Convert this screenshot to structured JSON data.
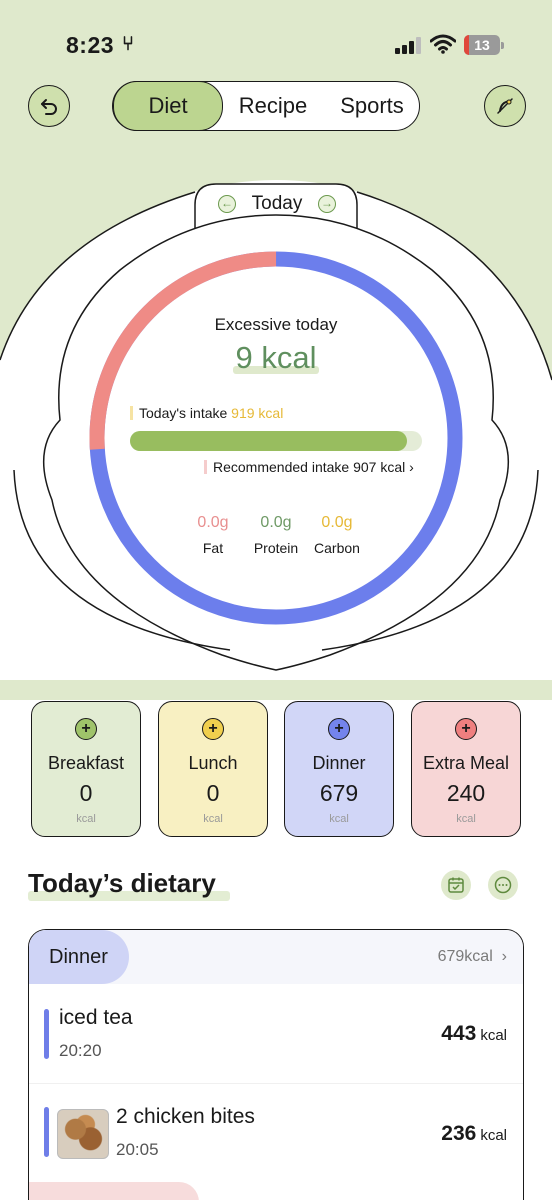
{
  "status_bar": {
    "time": "8:23",
    "battery": "13"
  },
  "tabs": [
    {
      "label": "Diet",
      "active": true
    },
    {
      "label": "Recipe",
      "active": false
    },
    {
      "label": "Sports",
      "active": false
    }
  ],
  "summary": {
    "day_label": "Today",
    "status_label": "Excessive today",
    "excess_value": "9 kcal",
    "intake_label": "Today's intake",
    "intake_value": "919 kcal",
    "recommended_text": "Recommended intake 907 kcal",
    "intake_ratio": 0.95,
    "macros": [
      {
        "value": "0.0g",
        "label": "Fat",
        "color": "#e88f8f"
      },
      {
        "value": "0.0g",
        "label": "Protein",
        "color": "#6f9a66"
      },
      {
        "value": "0.0g",
        "label": "Carbon",
        "color": "#e6b937"
      }
    ],
    "ring": {
      "red_fraction": 0.26,
      "red_color": "#ef8b86",
      "blue_color": "#6c7eec"
    }
  },
  "meals": [
    {
      "name": "Breakfast",
      "calories": "0",
      "unit": "kcal",
      "bg": "#e2ecd3",
      "plus_color": "#9fc36a"
    },
    {
      "name": "Lunch",
      "calories": "0",
      "unit": "kcal",
      "bg": "#f8f0c2",
      "plus_color": "#f0cf4e"
    },
    {
      "name": "Dinner",
      "calories": "679",
      "unit": "kcal",
      "bg": "#d1d6f7",
      "plus_color": "#7484ec"
    },
    {
      "name": "Extra Meal",
      "calories": "240",
      "unit": "kcal",
      "bg": "#f7d6d6",
      "plus_color": "#ef7f7f"
    }
  ],
  "dietary": {
    "title": "Today’s dietary",
    "group": {
      "label": "Dinner",
      "total": "679kcal"
    },
    "items": [
      {
        "name": "iced tea",
        "time": "20:20",
        "kcal": "443",
        "unit": "kcal"
      },
      {
        "name": "2 chicken bites",
        "time": "20:05",
        "kcal": "236",
        "unit": "kcal"
      }
    ]
  }
}
